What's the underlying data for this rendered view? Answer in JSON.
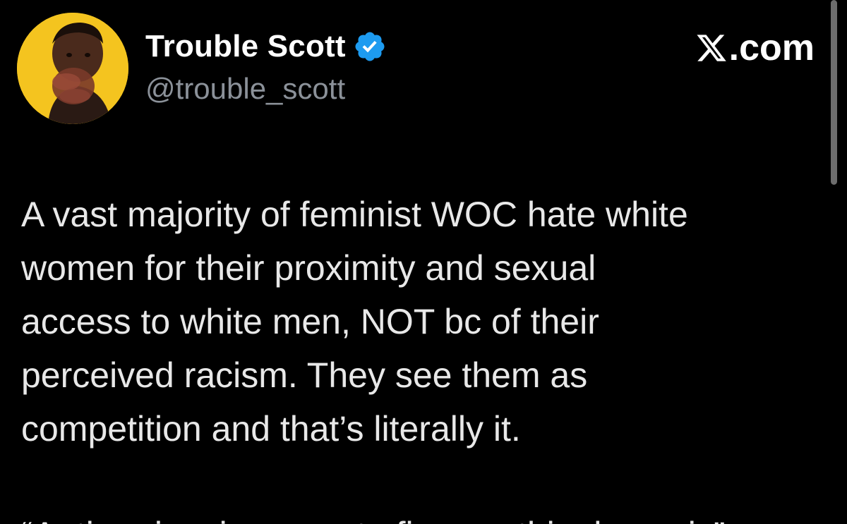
{
  "author": {
    "display_name": "Trouble Scott",
    "handle": "@trouble_scott",
    "verified_icon": "verified-badge-icon",
    "avatar_icon": "profile-photo"
  },
  "source": {
    "label": ".com",
    "icon": "x-logo-icon"
  },
  "tweet": {
    "lines": [
      "A vast majority of feminist WOC hate white",
      "women for their proximity and sexual",
      "access to white men, NOT bc of their",
      "perceived racism. They see them as",
      "competition and that’s literally it."
    ],
    "cutoff_line": "“Anti-racism is a way to finesse this dynamic”"
  },
  "colors": {
    "background": "#000000",
    "text": "#e8e8e8",
    "handle": "#8b9199",
    "verified": "#1d9bf0",
    "avatar_bg": "#f4c41f"
  }
}
